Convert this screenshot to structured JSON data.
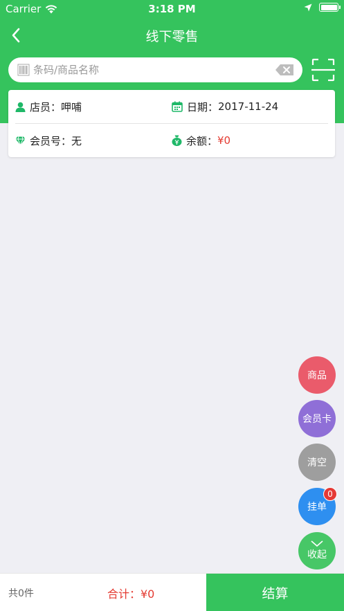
{
  "status_bar": {
    "carrier": "Carrier",
    "time": "3:18 PM"
  },
  "nav": {
    "title": "线下零售"
  },
  "search": {
    "placeholder": "条码/商品名称",
    "value": ""
  },
  "info": {
    "clerk_label": "店员：",
    "clerk_value": "呷哺",
    "date_label": "日期：",
    "date_value": "2017-11-24",
    "member_label": "会员号：",
    "member_value": "无",
    "balance_label": "余额：",
    "balance_value": "¥0"
  },
  "fabs": {
    "goods": "商品",
    "member_card": "会员卡",
    "clear": "清空",
    "hold": "挂单",
    "hold_count": "0",
    "collapse": "收起"
  },
  "footer": {
    "count": "共0件",
    "total": "合计：¥0",
    "checkout": "结算"
  },
  "colors": {
    "primary_green": "#35c35d",
    "price_red": "#e43b32"
  },
  "icons": [
    "wifi-icon",
    "location-arrow-icon",
    "battery-icon",
    "back-chevron-icon",
    "barcode-icon",
    "clear-input-icon",
    "scan-icon",
    "person-icon",
    "calendar-icon",
    "diamond-icon",
    "money-bag-icon",
    "chevron-down-icon"
  ]
}
